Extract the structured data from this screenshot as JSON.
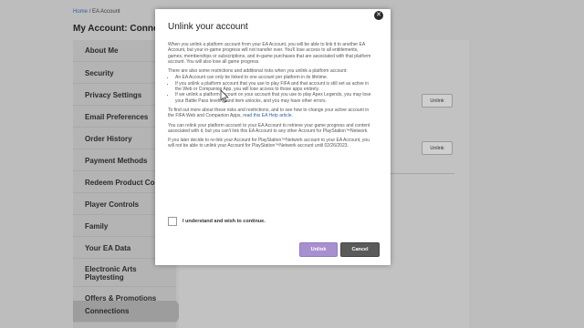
{
  "breadcrumb": {
    "home": "Home",
    "separator": "/",
    "current": "EA Account"
  },
  "page": {
    "title": "My Account: Connec"
  },
  "sidebar": {
    "items": [
      {
        "label": "About Me"
      },
      {
        "label": "Security"
      },
      {
        "label": "Privacy Settings"
      },
      {
        "label": "Email Preferences"
      },
      {
        "label": "Order History"
      },
      {
        "label": "Payment Methods"
      },
      {
        "label": "Redeem Product Co"
      },
      {
        "label": "Player Controls"
      },
      {
        "label": "Family"
      },
      {
        "label": "Your EA Data"
      },
      {
        "label": "Electronic Arts Playtesting"
      },
      {
        "label": "Offers & Promotions"
      },
      {
        "label": "Connections"
      }
    ]
  },
  "background": {
    "unlink_label_1": "Unlink",
    "unlink_label_2": "Unlink",
    "fragment": "s"
  },
  "modal": {
    "title": "Unlink your account",
    "close_symbol": "✕",
    "para1": "When you unlink a platform account from your EA Account, you will be able to link it to another EA Account, but your in-game progress will not transfer over. You'll lose access to all entitlements, games, memberships or subscriptions, and in-game purchases that are associated with that platform account. You will also lose all game progress.",
    "para2": "There are also some restrictions and additional risks when you unlink a platform account:",
    "bullets": [
      "An EA Account can only be linked to one account per platform in its lifetime.",
      "If you unlink a platform account that you use to play FIFA and that account is still set as active in the Web or Companion App, you will lose access to those apps entirely.",
      "If we unlink a platform account on your account that you use to play Apex Legends, you may lose your Battle Pass leveling and item unlocks, and you may have other errors."
    ],
    "para3_text": "To find out more about these risks and restrictions, and to see how to change your active account in the FIFA Web and Companion Apps,",
    "para3_link": "read this EA Help article.",
    "para4": "You can relink your platform account to your EA Account to retrieve your game progress and content associated with it, but you can't link this EA Account to any other Account for PlayStation™Network.",
    "para5": "If you later decide to re-link your Account for PlayStation™Network account to your EA Account, you will not be able to unlink your Account for PlayStation™Network account until 02/26/2023.",
    "consent_label": "I understand and wish to continue.",
    "unlink_button": "Unlink",
    "cancel_button": "Cancel",
    "colors": {
      "unlink": "#a890d0",
      "cancel": "#5a5a5a",
      "link": "#2f5fa5"
    }
  }
}
